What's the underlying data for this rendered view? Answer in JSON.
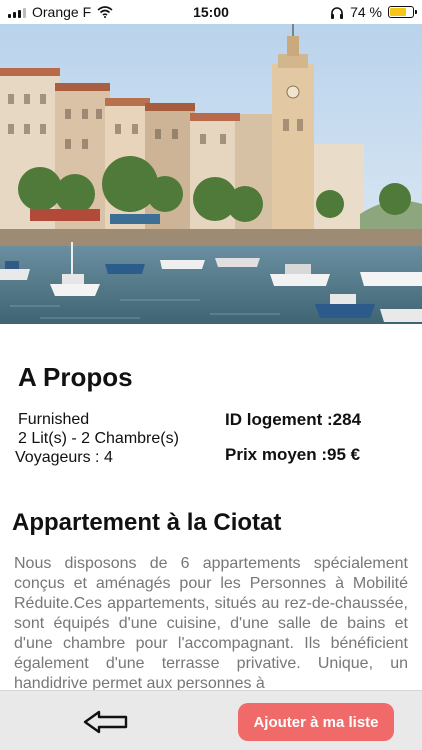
{
  "status_bar": {
    "carrier": "Orange F",
    "time": "15:00",
    "battery_percent": "74 %",
    "battery_level": 0.74
  },
  "about": {
    "title": "A Propos",
    "furnished": "Furnished",
    "rooms": "2 Lit(s) - 2 Chambre(s)",
    "travelers": "Voyageurs : 4",
    "housing_id": "ID logement :284",
    "avg_price": "Prix moyen :95 €"
  },
  "listing": {
    "title": "Appartement à la Ciotat",
    "description": "Nous disposons de 6 appartements spécialement conçus et aménagés pour les Personnes à Mobilité Réduite.Ces appartements, situés au rez-de-chaussée, sont équipés d'une cuisine, d'une salle de bains et d'une chambre pour l'accompagnant. Ils bénéficient également d'une terrasse privative. Unique, un handidrive permet aux personnes à"
  },
  "bottom_bar": {
    "add_label": "Ajouter à ma liste"
  },
  "colors": {
    "accent": "#f06a6a",
    "battery": "#f5c518",
    "bar_bg": "#e9e9ea"
  },
  "icons": [
    "wifi-icon",
    "headphones-icon",
    "battery-icon",
    "back-arrow-icon"
  ]
}
